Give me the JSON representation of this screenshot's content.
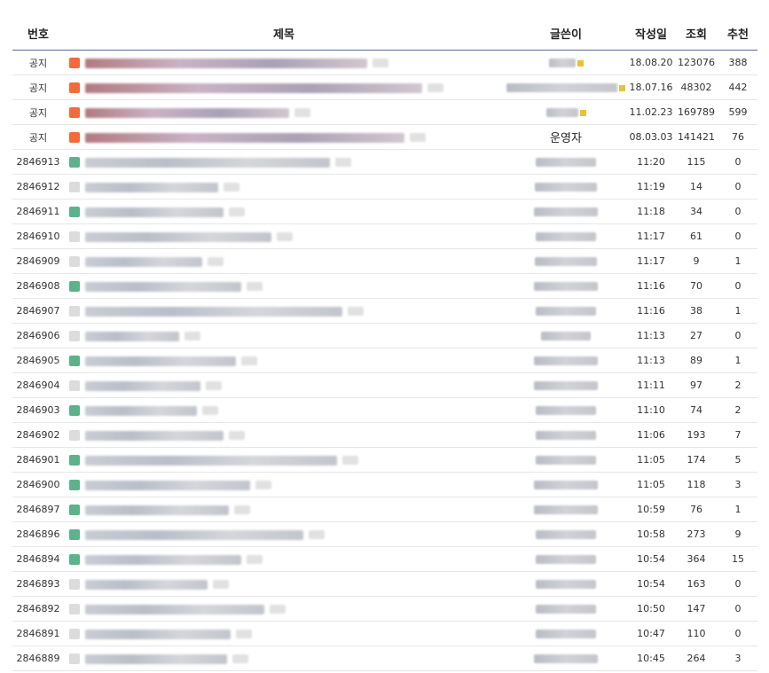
{
  "columns": {
    "no": "번호",
    "title": "제목",
    "author": "글쓴이",
    "date": "작성일",
    "views": "조회",
    "recommend": "추천"
  },
  "notice_label": "공지",
  "rows": [
    {
      "no": "공지",
      "icon": "notice-icon",
      "title_w": 318,
      "author": "",
      "author_w": 30,
      "date": "18.08.20",
      "views": "123076",
      "rec": "388"
    },
    {
      "no": "공지",
      "icon": "notice-icon",
      "title_w": 380,
      "author": "",
      "author_w": 125,
      "date": "18.07.16",
      "views": "48302",
      "rec": "442"
    },
    {
      "no": "공지",
      "icon": "notice-icon",
      "title_w": 230,
      "author": "",
      "author_w": 36,
      "date": "11.02.23",
      "views": "169789",
      "rec": "599"
    },
    {
      "no": "공지",
      "icon": "notice-icon",
      "title_w": 360,
      "author": "운영자",
      "author_w": 0,
      "date": "08.03.03",
      "views": "141421",
      "rec": "76"
    },
    {
      "no": "2846913",
      "icon": "image-icon",
      "title_w": 276,
      "author": "",
      "author_w": 68,
      "date": "11:20",
      "views": "115",
      "rec": "0"
    },
    {
      "no": "2846912",
      "icon": "plain-icon",
      "title_w": 150,
      "author": "",
      "author_w": 70,
      "date": "11:19",
      "views": "14",
      "rec": "0"
    },
    {
      "no": "2846911",
      "icon": "image-icon",
      "title_w": 156,
      "author": "",
      "author_w": 72,
      "date": "11:18",
      "views": "34",
      "rec": "0"
    },
    {
      "no": "2846910",
      "icon": "plain-icon",
      "title_w": 210,
      "author": "",
      "author_w": 68,
      "date": "11:17",
      "views": "61",
      "rec": "0"
    },
    {
      "no": "2846909",
      "icon": "plain-icon",
      "title_w": 132,
      "author": "",
      "author_w": 70,
      "date": "11:17",
      "views": "9",
      "rec": "1"
    },
    {
      "no": "2846908",
      "icon": "image-icon",
      "title_w": 176,
      "author": "",
      "author_w": 72,
      "date": "11:16",
      "views": "70",
      "rec": "0"
    },
    {
      "no": "2846907",
      "icon": "plain-icon",
      "title_w": 290,
      "author": "",
      "author_w": 68,
      "date": "11:16",
      "views": "38",
      "rec": "1"
    },
    {
      "no": "2846906",
      "icon": "plain-icon",
      "title_w": 106,
      "author": "",
      "author_w": 56,
      "date": "11:13",
      "views": "27",
      "rec": "0"
    },
    {
      "no": "2846905",
      "icon": "image-icon",
      "title_w": 170,
      "author": "",
      "author_w": 72,
      "date": "11:13",
      "views": "89",
      "rec": "1"
    },
    {
      "no": "2846904",
      "icon": "plain-icon",
      "title_w": 130,
      "author": "",
      "author_w": 72,
      "date": "11:11",
      "views": "97",
      "rec": "2"
    },
    {
      "no": "2846903",
      "icon": "image-icon",
      "title_w": 126,
      "author": "",
      "author_w": 68,
      "date": "11:10",
      "views": "74",
      "rec": "2"
    },
    {
      "no": "2846902",
      "icon": "plain-icon",
      "title_w": 156,
      "author": "",
      "author_w": 68,
      "date": "11:06",
      "views": "193",
      "rec": "7"
    },
    {
      "no": "2846901",
      "icon": "image-icon",
      "title_w": 284,
      "author": "",
      "author_w": 68,
      "date": "11:05",
      "views": "174",
      "rec": "5"
    },
    {
      "no": "2846900",
      "icon": "image-icon",
      "title_w": 186,
      "author": "",
      "author_w": 72,
      "date": "11:05",
      "views": "118",
      "rec": "3"
    },
    {
      "no": "2846897",
      "icon": "image-icon",
      "title_w": 162,
      "author": "",
      "author_w": 72,
      "date": "10:59",
      "views": "76",
      "rec": "1"
    },
    {
      "no": "2846896",
      "icon": "image-icon",
      "title_w": 246,
      "author": "",
      "author_w": 68,
      "date": "10:58",
      "views": "273",
      "rec": "9"
    },
    {
      "no": "2846894",
      "icon": "image-icon",
      "title_w": 176,
      "author": "",
      "author_w": 68,
      "date": "10:54",
      "views": "364",
      "rec": "15"
    },
    {
      "no": "2846893",
      "icon": "plain-icon",
      "title_w": 138,
      "author": "",
      "author_w": 68,
      "date": "10:54",
      "views": "163",
      "rec": "0"
    },
    {
      "no": "2846892",
      "icon": "plain-icon",
      "title_w": 202,
      "author": "",
      "author_w": 68,
      "date": "10:50",
      "views": "147",
      "rec": "0"
    },
    {
      "no": "2846891",
      "icon": "plain-icon",
      "title_w": 164,
      "author": "",
      "author_w": 68,
      "date": "10:47",
      "views": "110",
      "rec": "0"
    },
    {
      "no": "2846889",
      "icon": "plain-icon",
      "title_w": 160,
      "author": "",
      "author_w": 72,
      "date": "10:45",
      "views": "264",
      "rec": "3"
    }
  ]
}
